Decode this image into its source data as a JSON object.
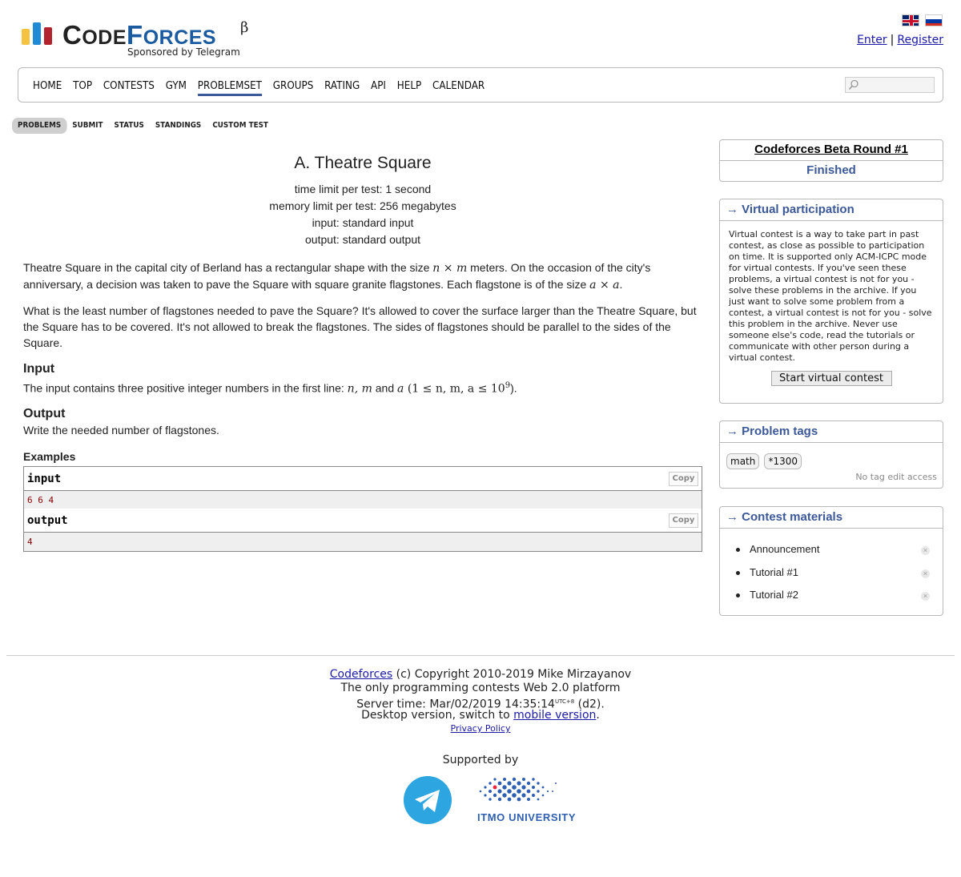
{
  "header": {
    "logo_main": "CODE",
    "logo_forces": "FORCES",
    "logo_beta": "β",
    "sponsor": "Sponsored by Telegram",
    "enter": "Enter",
    "separator": "|",
    "register": "Register",
    "colors": {
      "bar1": "#f5c242",
      "bar2": "#1f8ad6",
      "bar3": "#b3232d",
      "brand_blue": "#1a5aa0"
    }
  },
  "menu": {
    "items": [
      "HOME",
      "TOP",
      "CONTESTS",
      "GYM",
      "PROBLEMSET",
      "GROUPS",
      "RATING",
      "API",
      "HELP",
      "CALENDAR"
    ],
    "active": "PROBLEMSET",
    "search_icon": "search-icon"
  },
  "subtabs": {
    "items": [
      "PROBLEMS",
      "SUBMIT",
      "STATUS",
      "STANDINGS",
      "CUSTOM TEST"
    ],
    "active": "PROBLEMS"
  },
  "problem": {
    "title": "A. Theatre Square",
    "time_limit": "time limit per test: 1 second",
    "memory_limit": "memory limit per test: 256 megabytes",
    "input": "input: standard input",
    "output": "output: standard output",
    "p1_a": "Theatre Square in the capital city of Berland has a rectangular shape with the size ",
    "p1_math1": "n × m",
    "p1_b": " meters. On the occasion of the city's anniversary, a decision was taken to pave the Square with square granite flagstones. Each flagstone is of the size ",
    "p1_math2": "a × a",
    "p1_c": ".",
    "p2": "What is the least number of flagstones needed to pave the Square? It's allowed to cover the surface larger than the Theatre Square, but the Square has to be covered. It's not allowed to break the flagstones. The sides of flagstones should be parallel to the sides of the Square.",
    "input_title": "Input",
    "input_a": "The input contains three positive integer numbers in the first line: ",
    "input_math1": "n,  m",
    "input_and": " and ",
    "input_math2": "a",
    "input_math3": " (1 ≤ n, m, a ≤ 10",
    "input_sup": "9",
    "input_end": ").",
    "output_title": "Output",
    "output_text": "Write the needed number of flagstones.",
    "examples_title": "Examples",
    "ex_input_label": "input",
    "ex_input_value": "6 6 4",
    "ex_output_label": "output",
    "ex_output_value": "4",
    "copy": "Copy"
  },
  "sidebar": {
    "round_name": "Codeforces Beta Round #1",
    "round_status": "Finished",
    "vp_title": "→ Virtual participation",
    "vp_text": "Virtual contest is a way to take part in past contest, as close as possible to participation on time. It is supported only ACM-ICPC mode for virtual contests. If you've seen these problems, a virtual contest is not for you - solve these problems in the archive. If you just want to solve some problem from a contest, a virtual contest is not for you - solve this problem in the archive. Never use someone else's code, read the tutorials or communicate with other person during a virtual contest.",
    "vp_button": "Start virtual contest",
    "tags_title": "→ Problem tags",
    "tags": [
      "math",
      "*1300"
    ],
    "no_tag_edit": "No tag edit access",
    "materials_title": "→ Contest materials",
    "materials": [
      "Announcement",
      "Tutorial #1",
      "Tutorial #2"
    ]
  },
  "footer": {
    "codeforces_link": "Codeforces",
    "copyright": " (c) Copyright 2010-2019 Mike Mirzayanov",
    "tagline": "The only programming contests Web 2.0 platform",
    "server_time_label": "Server time: Mar/02/2019 14:35:14",
    "server_tz": "UTC+8",
    "server_suffix": " (d2).",
    "desktop_a": "Desktop version, switch to ",
    "mobile_link": "mobile version",
    "desktop_b": ".",
    "privacy": "Privacy Policy",
    "supported_by": "Supported by",
    "itmo": "ITMO UNIVERSITY",
    "colors": {
      "telegram": "#2ca5e0",
      "itmo": "#2e5fb1",
      "itmo_dot": "#e8253b"
    }
  }
}
